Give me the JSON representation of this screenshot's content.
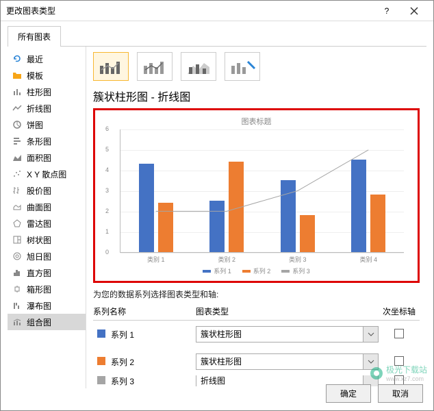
{
  "dialog": {
    "title": "更改图表类型",
    "tab": "所有图表"
  },
  "sidebar": {
    "items": [
      {
        "label": "最近"
      },
      {
        "label": "模板"
      },
      {
        "label": "柱形图"
      },
      {
        "label": "折线图"
      },
      {
        "label": "饼图"
      },
      {
        "label": "条形图"
      },
      {
        "label": "面积图"
      },
      {
        "label": "X Y 散点图"
      },
      {
        "label": "股价图"
      },
      {
        "label": "曲面图"
      },
      {
        "label": "雷达图"
      },
      {
        "label": "树状图"
      },
      {
        "label": "旭日图"
      },
      {
        "label": "直方图"
      },
      {
        "label": "箱形图"
      },
      {
        "label": "瀑布图"
      },
      {
        "label": "组合图"
      }
    ]
  },
  "main": {
    "chart_type_label": "簇状柱形图 - 折线图",
    "preview_title": "图表标题",
    "prompt": "为您的数据系列选择图表类型和轴:",
    "grid": {
      "col_name": "系列名称",
      "col_type": "图表类型",
      "col_axis": "次坐标轴",
      "rows": [
        {
          "name": "系列 1",
          "type": "簇状柱形图",
          "color": "#4472C4"
        },
        {
          "name": "系列 2",
          "type": "簇状柱形图",
          "color": "#ED7D31"
        },
        {
          "name": "系列 3",
          "type": "折线图",
          "color": "#A5A5A5"
        }
      ]
    },
    "legend": {
      "s1": "系列 1",
      "s2": "系列 2",
      "s3": "系列 3"
    }
  },
  "footer": {
    "ok": "确定",
    "cancel": "取消"
  },
  "watermark": {
    "text": "极光下载站",
    "url": "www.xz7.com"
  },
  "chart_data": {
    "type": "bar+line",
    "title": "图表标题",
    "categories": [
      "类别 1",
      "类别 2",
      "类别 3",
      "类别 4"
    ],
    "series": [
      {
        "name": "系列 1",
        "type": "bar",
        "color": "#4472C4",
        "values": [
          4.3,
          2.5,
          3.5,
          4.5
        ]
      },
      {
        "name": "系列 2",
        "type": "bar",
        "color": "#ED7D31",
        "values": [
          2.4,
          4.4,
          1.8,
          2.8
        ]
      },
      {
        "name": "系列 3",
        "type": "line",
        "color": "#A5A5A5",
        "values": [
          2,
          2,
          3,
          5
        ]
      }
    ],
    "ylim": [
      0,
      6
    ],
    "yticks": [
      0,
      1,
      2,
      3,
      4,
      5,
      6
    ]
  }
}
